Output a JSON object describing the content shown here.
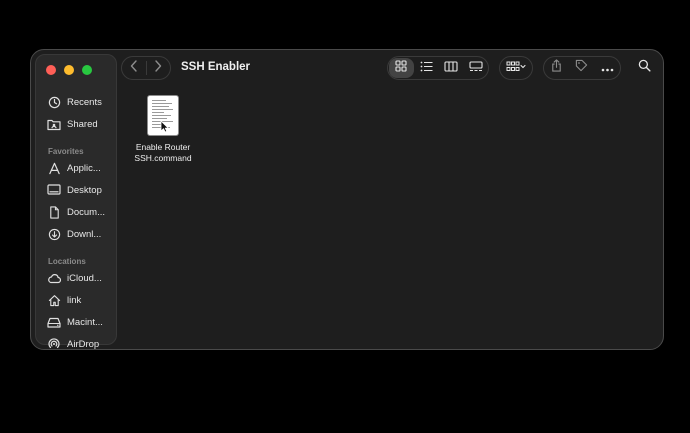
{
  "window": {
    "title": "SSH Enabler",
    "traffic_lights": [
      "close",
      "minimize",
      "zoom"
    ]
  },
  "colors": {
    "close": "#ff5f57",
    "minimize": "#febc2e",
    "zoom": "#28c840",
    "window_bg": "#1e1e1e",
    "sidebar_bg": "#2a2a2a"
  },
  "sidebar": {
    "recents": {
      "label": "Recents",
      "icon": "clock-icon"
    },
    "shared": {
      "label": "Shared",
      "icon": "shared-folder-icon"
    },
    "favorites_heading": "Favorites",
    "favorites": [
      {
        "label": "Applic...",
        "icon": "applications-icon"
      },
      {
        "label": "Desktop",
        "icon": "desktop-icon"
      },
      {
        "label": "Docum...",
        "icon": "document-icon"
      },
      {
        "label": "Downl...",
        "icon": "download-icon"
      }
    ],
    "locations_heading": "Locations",
    "locations": [
      {
        "label": "iCloud...",
        "icon": "cloud-icon"
      },
      {
        "label": "link",
        "icon": "home-icon"
      },
      {
        "label": "Macint...",
        "icon": "drive-icon"
      },
      {
        "label": "AirDrop",
        "icon": "airdrop-icon"
      }
    ]
  },
  "toolbar": {
    "back_icon": "chevron-left-icon",
    "forward_icon": "chevron-right-icon",
    "views": [
      "icon-view",
      "list-view",
      "column-view",
      "gallery-view"
    ],
    "active_view": "icon-view",
    "group_icon": "group-grid-icon",
    "share_icon": "share-icon",
    "tag_icon": "tag-icon",
    "more_icon": "more-icon",
    "search_icon": "search-icon"
  },
  "files": [
    {
      "name_line1": "Enable Router",
      "name_line2": "SSH.command",
      "icon": "command-script-icon"
    }
  ]
}
